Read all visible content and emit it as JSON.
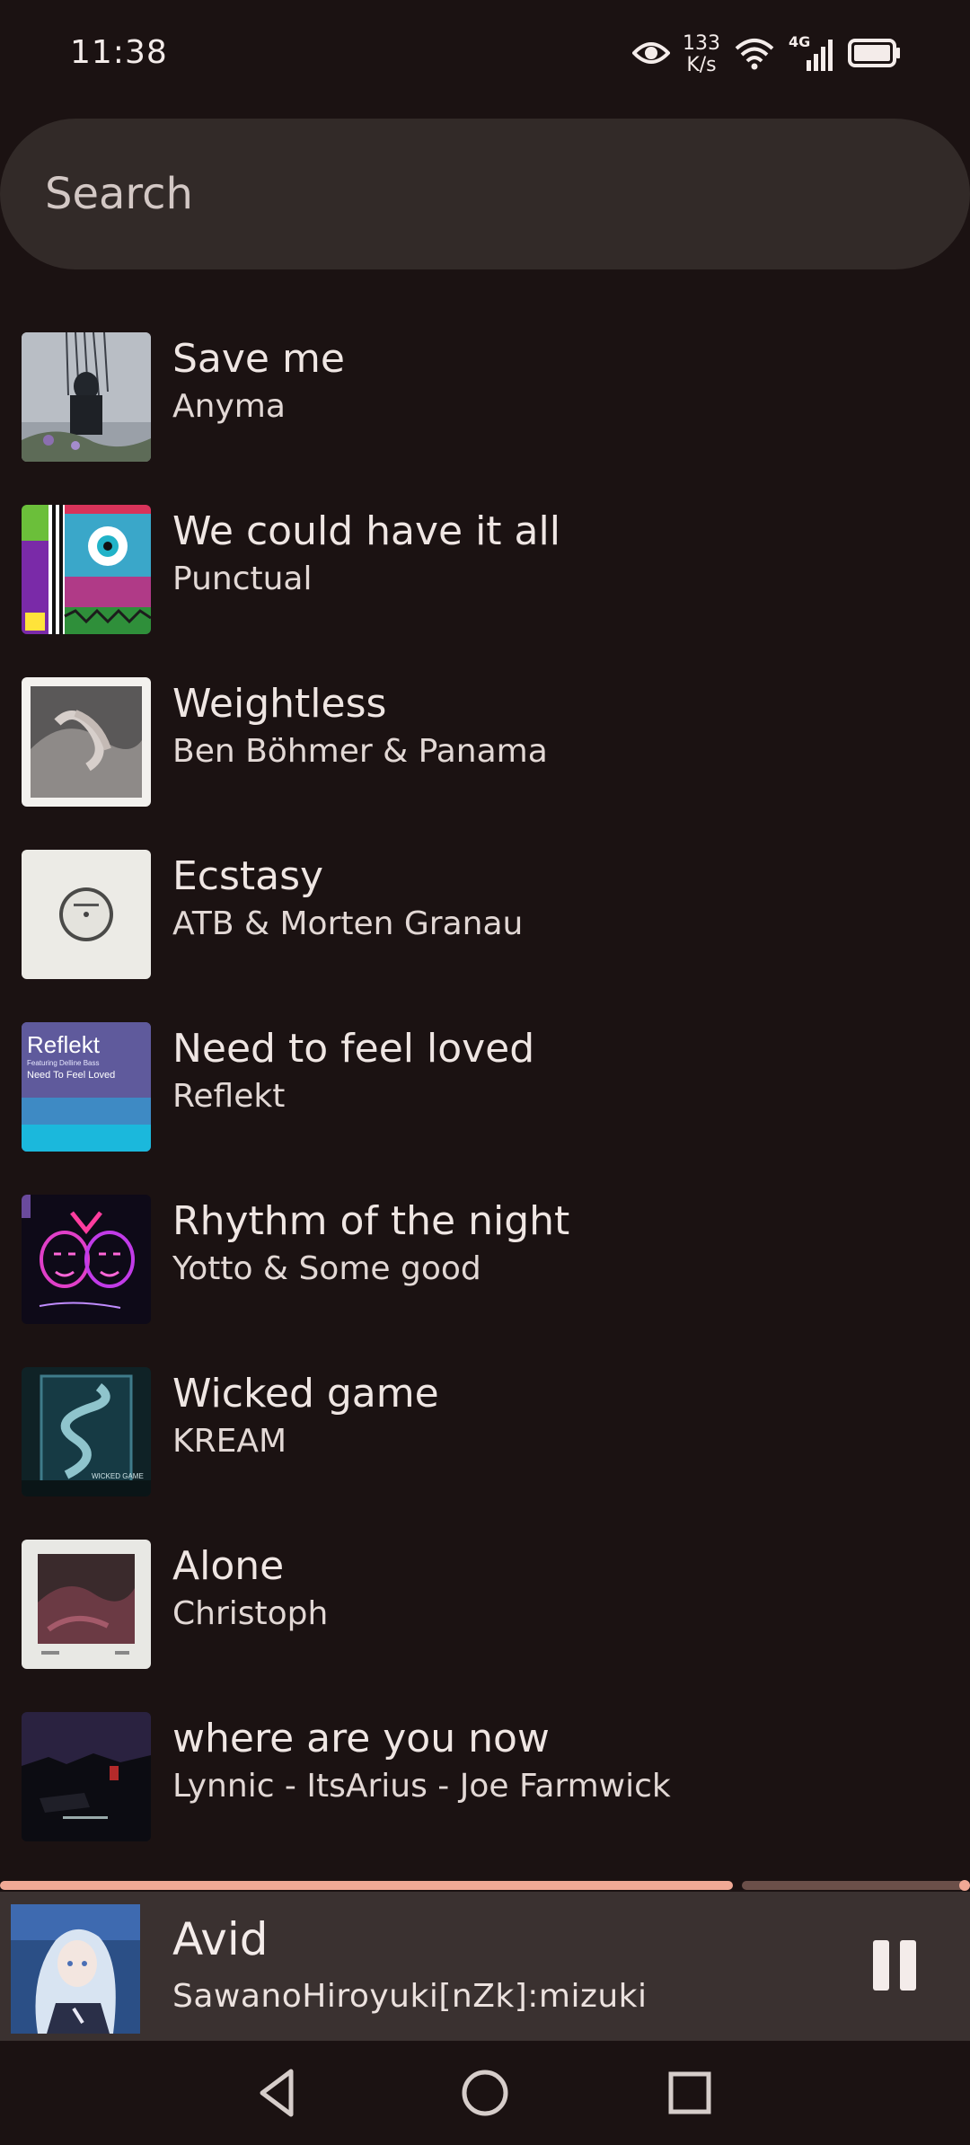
{
  "status_bar": {
    "time": "11:38",
    "net_speed_value": "133",
    "net_speed_unit": "K/s",
    "network_type": "4G"
  },
  "search": {
    "placeholder": "Search"
  },
  "tracks": [
    {
      "title": "Save me",
      "artist": "Anyma"
    },
    {
      "title": "We could have it all",
      "artist": "Punctual"
    },
    {
      "title": "Weightless",
      "artist": "Ben Böhmer & Panama"
    },
    {
      "title": "Ecstasy",
      "artist": "ATB & Morten Granau"
    },
    {
      "title": "Need to feel loved",
      "artist": "Reflekt"
    },
    {
      "title": "Rhythm of the night",
      "artist": "Yotto & Some good"
    },
    {
      "title": "Wicked game",
      "artist": "KREAM"
    },
    {
      "title": "Alone",
      "artist": "Christoph"
    },
    {
      "title": "where are you now",
      "artist": "Lynnic - ItsArius - Joe Farmwick"
    }
  ],
  "cover_text": {
    "reflekt_title": "Reflekt",
    "reflekt_featuring": "Featuring Delline Bass",
    "reflekt_song": "Need To Feel Loved",
    "wicked_game": "WICKED GAME"
  },
  "now_playing": {
    "title": "Avid",
    "artist": "SawanoHiroyuki[nZk]:mizuki",
    "progress": 0.76
  },
  "colors": {
    "background": "#1b1212",
    "accent": "#f1a995",
    "search_bg": "#322a28",
    "player_bg": "#3a3130"
  },
  "icons": {
    "eye": "eye-icon",
    "wifi": "wifi-icon",
    "signal": "signal-icon",
    "battery": "battery-icon",
    "pause": "pause-icon",
    "back": "back-icon",
    "home": "home-icon",
    "recents": "recents-icon"
  }
}
